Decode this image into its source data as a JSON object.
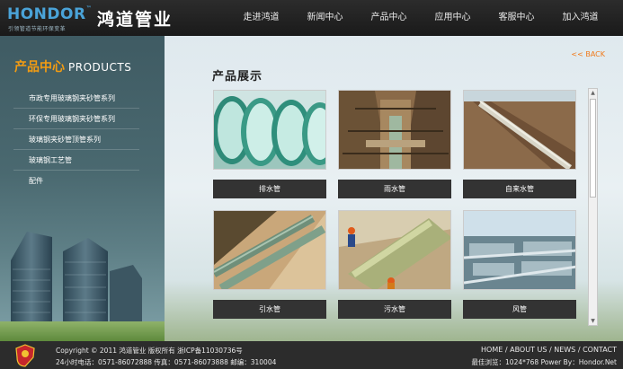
{
  "header": {
    "logo_en": "HONDOR",
    "logo_tagline": "引领管道节能环保变革",
    "logo_cn": "鸿道管业",
    "nav": [
      "走进鸿道",
      "新闻中心",
      "产品中心",
      "应用中心",
      "客服中心",
      "加入鸿道"
    ]
  },
  "sidebar": {
    "title_cn": "产品中心",
    "title_en": "PRODUCTS",
    "items": [
      "市政专用玻璃钢夹砂管系列",
      "环保专用玻璃钢夹砂管系列",
      "玻璃钢夹砂管顶管系列",
      "玻璃钢工艺管",
      "配件"
    ]
  },
  "main": {
    "back_label": "<< BACK",
    "title": "产品展示",
    "products": [
      {
        "label": "排水管",
        "image": "green-pipes-closeup"
      },
      {
        "label": "雨水管",
        "image": "trench-pipe"
      },
      {
        "label": "自来水管",
        "image": "pipe-in-ditch"
      },
      {
        "label": "引水管",
        "image": "double-pipeline"
      },
      {
        "label": "污水管",
        "image": "workers-large-pipe"
      },
      {
        "label": "风管",
        "image": "industrial-pipes"
      }
    ]
  },
  "footer": {
    "copyright": "Copyright © 2011  鸿道管业  版权所有  浙ICP备11030736号",
    "contact": "24小时电话：0571-86072888 传真：0571-86073888 邮编：310004",
    "links": [
      "HOME",
      "ABOUT US",
      "NEWS",
      "CONTACT"
    ],
    "info": "最佳浏览：1024*768  Power By：Hondor.Net"
  },
  "colors": {
    "accent": "#f39c12",
    "brand_blue": "#4aa3d8",
    "header_bg": "#1f1f1f"
  }
}
